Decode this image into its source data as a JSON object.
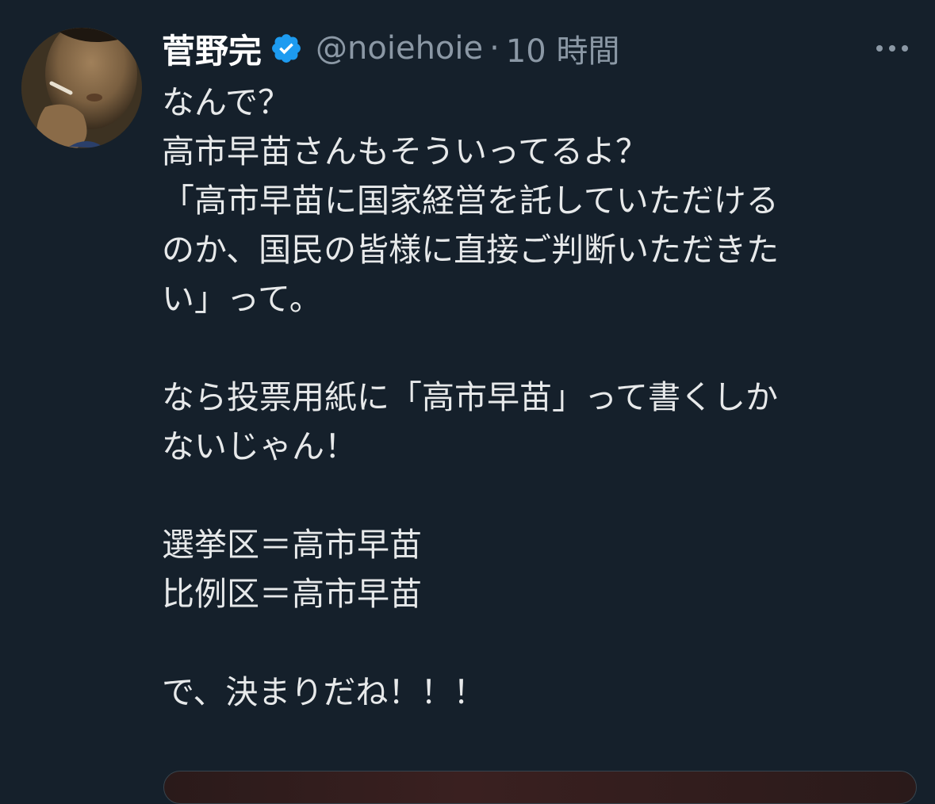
{
  "user": {
    "display_name": "菅野完",
    "handle": "@noiehoie",
    "separator": "·",
    "time": "10 時間",
    "verified": true
  },
  "icons": {
    "verified": "verified-badge-icon",
    "more": "more-horizontal-icon"
  },
  "colors": {
    "background": "#15202b",
    "text": "#e7e9ea",
    "secondary_text": "#8b98a5",
    "verified_blue": "#1d9bf0"
  },
  "tweet": {
    "lines": [
      "なんで？",
      "高市早苗さんもそういってるよ？",
      "「高市早苗に国家経営を託していただける",
      "のか、国民の皆様に直接ご判断いただきた",
      "い」って。",
      "",
      "なら投票用紙に「高市早苗」って書くしか",
      "ないじゃん！",
      "",
      "選挙区＝高市早苗",
      "比例区＝高市早苗",
      "",
      "で、決まりだね！！！"
    ]
  }
}
